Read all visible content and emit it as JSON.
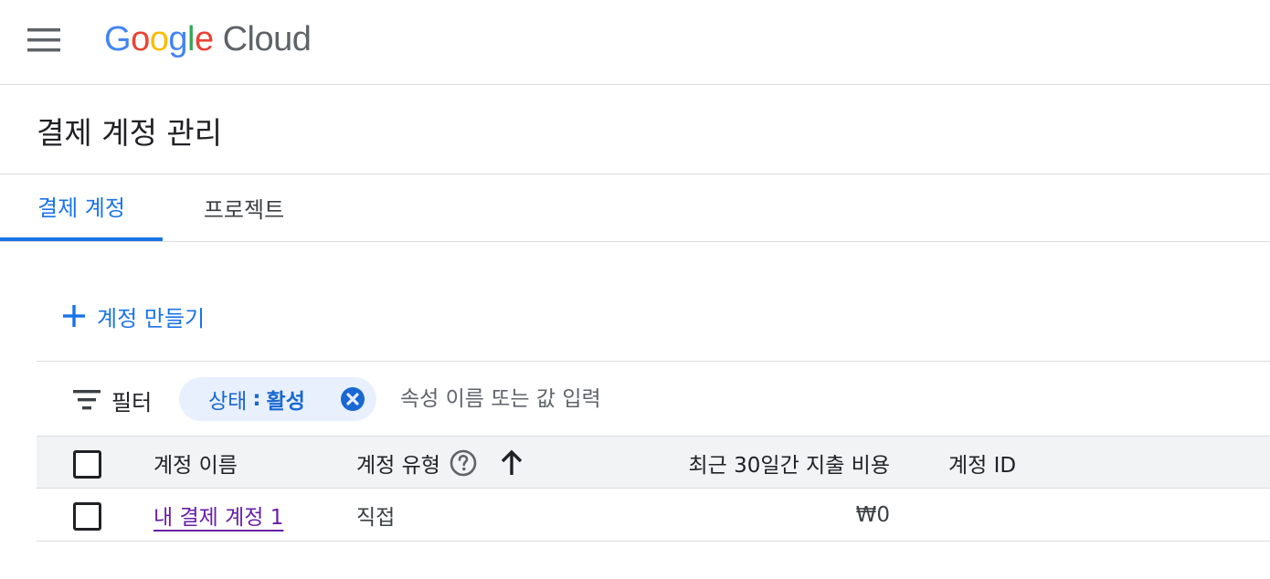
{
  "header": {
    "logo": {
      "google_letters": [
        "G",
        "o",
        "o",
        "g",
        "l",
        "e"
      ],
      "product": "Cloud"
    },
    "menu_icon": "hamburger-menu-icon"
  },
  "page": {
    "title": "결제 계정 관리"
  },
  "tabs": [
    {
      "label": "결제 계정",
      "active": true
    },
    {
      "label": "프로젝트",
      "active": false
    }
  ],
  "actions": {
    "create_account_label": "계정 만들기"
  },
  "filter": {
    "label": "필터",
    "chip": {
      "key": "상태",
      "separator": ":",
      "value": "활성"
    },
    "input_placeholder": "속성 이름 또는 값 입력",
    "input_value": ""
  },
  "table": {
    "columns": [
      {
        "label": "계정 이름"
      },
      {
        "label": "계정 유형"
      },
      {
        "label": "최근 30일간 지출 비용"
      },
      {
        "label": "계정 ID"
      }
    ],
    "rows": [
      {
        "account_name": "내 결제 계정 1",
        "account_type": "직접",
        "cost_30d": "₩0",
        "account_id": ""
      }
    ]
  },
  "colors": {
    "accent": "#1a73e8",
    "link_visited": "#681da8",
    "chip_bg": "#e8f0fe",
    "header_bg": "#f1f3f4",
    "divider": "#dadce0"
  }
}
